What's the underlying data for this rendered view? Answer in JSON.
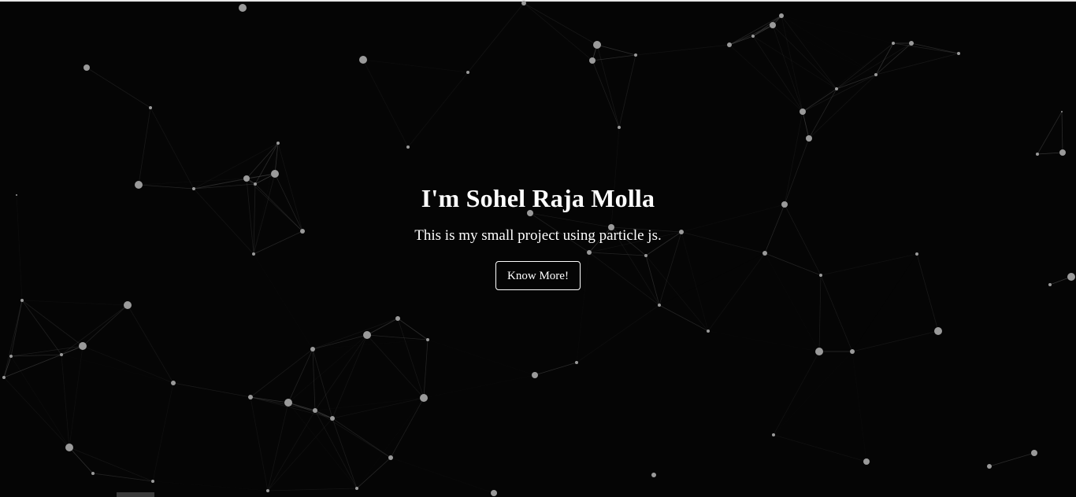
{
  "hero": {
    "title": "I'm Sohel Raja Molla",
    "subtitle": "This is my small project using particle js.",
    "button_label": "Know More!"
  },
  "colors": {
    "background": "#050505",
    "particle": "#9a9a9a",
    "link": "#4a4a4a",
    "text": "#ffffff"
  }
}
